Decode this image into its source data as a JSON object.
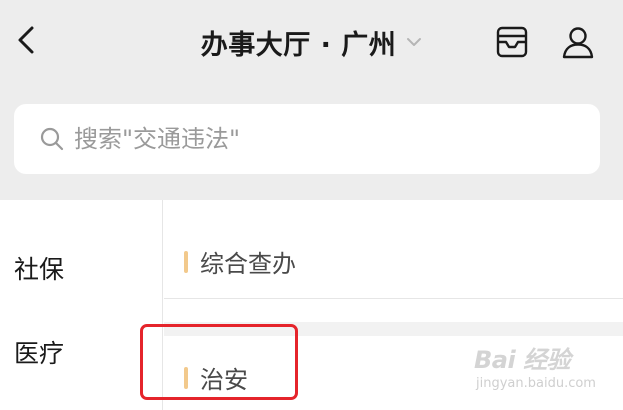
{
  "header": {
    "title": "办事大厅 · 广州",
    "back_icon": "chevron-left-icon",
    "title_caret_icon": "chevron-down-icon",
    "inbox_icon": "inbox-icon",
    "user_icon": "user-icon"
  },
  "search": {
    "placeholder": "搜索\"交通违法\"",
    "value": "",
    "icon": "search-icon"
  },
  "categories": [
    {
      "label": "社保"
    },
    {
      "label": "医疗"
    }
  ],
  "sections": [
    {
      "title": "综合查办"
    },
    {
      "title": "治安"
    }
  ],
  "watermark": {
    "brand": "Bai 经验",
    "url": "jingyan.baidu.com"
  },
  "colors": {
    "header_bg": "#ededed",
    "accent": "#f2c98c",
    "highlight": "#e5242b"
  }
}
